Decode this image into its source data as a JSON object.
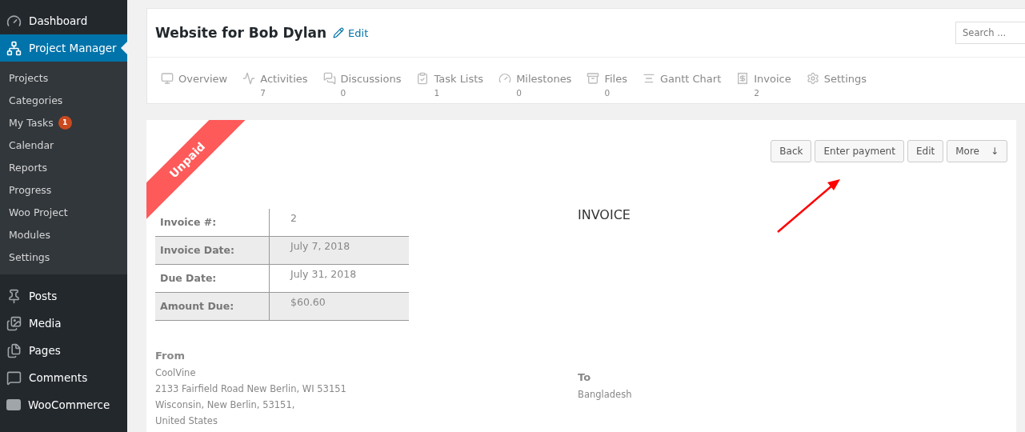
{
  "sidebar": {
    "menu": [
      {
        "label": "Dashboard",
        "selected": false
      },
      {
        "label": "Project Manager",
        "selected": true,
        "children": [
          {
            "label": "Projects"
          },
          {
            "label": "Categories"
          },
          {
            "label": "My Tasks",
            "badge": "1"
          },
          {
            "label": "Calendar"
          },
          {
            "label": "Reports"
          },
          {
            "label": "Progress"
          },
          {
            "label": "Woo Project"
          },
          {
            "label": "Modules"
          },
          {
            "label": "Settings"
          }
        ]
      },
      {
        "label": "Posts",
        "selected": false
      },
      {
        "label": "Media",
        "selected": false
      },
      {
        "label": "Pages",
        "selected": false
      },
      {
        "label": "Comments",
        "selected": false
      },
      {
        "label": "WooCommerce",
        "selected": false
      }
    ]
  },
  "header": {
    "title": "Website for Bob Dylan",
    "edit_link": "Edit",
    "search": {
      "placeholder": "Search ..."
    },
    "tabs": [
      {
        "label": "Overview"
      },
      {
        "label": "Activities",
        "count": "7"
      },
      {
        "label": "Discussions",
        "count": "0"
      },
      {
        "label": "Task Lists",
        "count": "1"
      },
      {
        "label": "Milestones",
        "count": "0"
      },
      {
        "label": "Files",
        "count": "0"
      },
      {
        "label": "Gantt Chart"
      },
      {
        "label": "Invoice",
        "count": "2"
      },
      {
        "label": "Settings"
      }
    ]
  },
  "invoice": {
    "ribbon": "Unpaid",
    "buttons": [
      {
        "label": "Back"
      },
      {
        "label": "Enter payment"
      },
      {
        "label": "Edit"
      },
      {
        "label": "More",
        "caret": "↓"
      }
    ],
    "heading": "INVOICE",
    "details": [
      {
        "label": "Invoice #:",
        "value": "2"
      },
      {
        "label": "Invoice Date:",
        "value": "July 7, 2018"
      },
      {
        "label": "Due Date:",
        "value": "July 31, 2018"
      },
      {
        "label": "Amount Due:",
        "value": "$60.60"
      }
    ],
    "from": {
      "title": "From",
      "lines": [
        "CoolVine",
        "2133 Fairfield Road New Berlin, WI 53151",
        "Wisconsin, New Berlin, 53151,",
        "United States"
      ]
    },
    "to": {
      "title": "To",
      "lines": [
        "Bangladesh"
      ]
    }
  }
}
